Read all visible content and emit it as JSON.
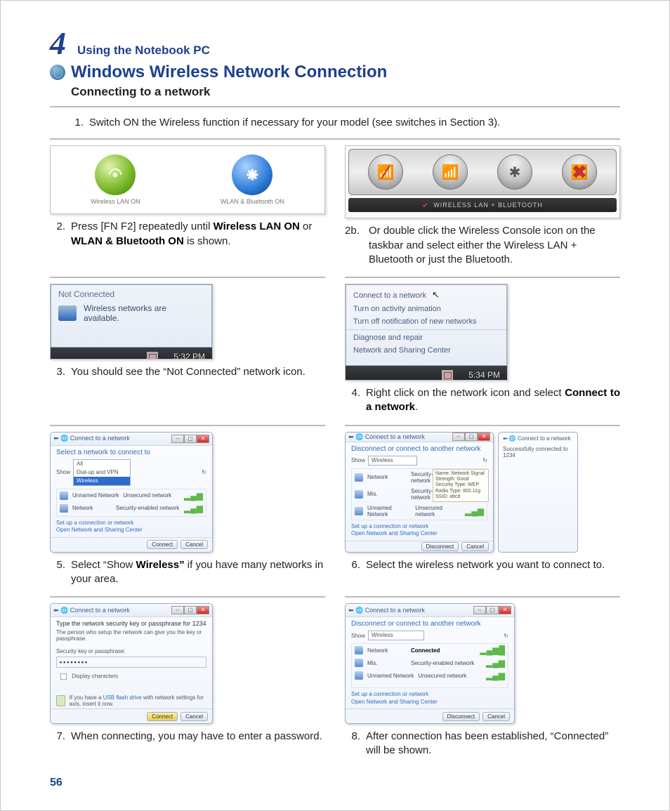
{
  "chapter": {
    "number": "4",
    "title": "Using the Notebook PC"
  },
  "heading": "Windows Wireless Network Connection",
  "subheading": "Connecting to a network",
  "page_number": "56",
  "step1": {
    "num": "1.",
    "text": "Switch ON the Wireless function if necessary for your model (see switches in Section 3)."
  },
  "fig2": {
    "cap1": "Wireless LAN ON",
    "cap2": "WLAN & Bluetooth ON"
  },
  "step2": {
    "num": "2.",
    "pre": "Press [FN F2] repeatedly until ",
    "b1": "Wireless LAN ON",
    "mid": " or ",
    "b2": "WLAN & Bluetooth ON",
    "post": " is shown."
  },
  "fig2b": {
    "label": "WIRELESS LAN + BLUETOOTH"
  },
  "step2b": {
    "num": "2b.",
    "text": "Or double click the Wireless Console icon on the taskbar and select either the Wireless LAN + Bluetooth or just the Bluetooth."
  },
  "fig3": {
    "title": "Not Connected",
    "msg": "Wireless networks are available.",
    "time": "5:32 PM"
  },
  "step3": {
    "num": "3.",
    "text": "You should see the “Not Connected” network icon."
  },
  "fig4": {
    "m1": "Connect to a network",
    "m2": "Turn on activity animation",
    "m3": "Turn off notification of new networks",
    "m4": "Diagnose and repair",
    "m5": "Network and Sharing Center",
    "time": "5:34 PM"
  },
  "step4": {
    "num": "4.",
    "pre": "Right click on the network icon and select ",
    "b": "Connect to a network",
    "post": "."
  },
  "fig5": {
    "wintitle": "Connect to a network",
    "title": "Select a network to connect to",
    "show": "Show",
    "all": "All",
    "dd1": "All",
    "dd2": "Dial-up and VPN",
    "dd3": "Wireless",
    "n2": "Unnamed Network",
    "n2d": "Unsecured network",
    "n3": "Network",
    "n3d": "Security-enabled network",
    "link1": "Set up a connection or network",
    "link2": "Open Network and Sharing Center",
    "btn1": "Connect",
    "btn2": "Cancel"
  },
  "step5": {
    "num": "5.",
    "pre": "Select “Show ",
    "b": "Wireless”",
    "post": " if you have many networks in your area."
  },
  "fig6": {
    "wintitle": "Connect to a network",
    "title": "Disconnect or connect to another network",
    "show": "Show",
    "val": "Wireless",
    "n1": "Network",
    "n1d": "Security-enabled network",
    "n2": "Mis.",
    "n2d": "Security-enabled network",
    "n3": "Unnamed Network",
    "n3d": "Unsecured network",
    "side_top": "Connect to a network",
    "side_msg": "Successfully connected to 1234",
    "tip": "Name: Network\nSignal Strength: Good\nSecurity Type: WEP\nRadio Type: 802.11g\nSSID: abcd",
    "link1": "Set up a connection or network",
    "link2": "Open Network and Sharing Center",
    "btn1": "Disconnect",
    "btn2": "Cancel"
  },
  "step6": {
    "num": "6.",
    "text": "Select the wireless network you want to connect to."
  },
  "fig7": {
    "wintitle": "Connect to a network",
    "title": "Type the network security key or passphrase for 1234",
    "sub": "The person who setup the network can give you the key or passphrase.",
    "label": "Security key or passphrase:",
    "value": "••••••••",
    "chk": "Display characters",
    "hint_pre": "If you have a ",
    "hint_link": "USB flash drive",
    "hint_post": " with network settings for axis, insert it now.",
    "btn1": "Connect",
    "btn2": "Cancel"
  },
  "step7": {
    "num": "7.",
    "text": "When connecting, you may have to enter a password."
  },
  "fig8": {
    "wintitle": "Connect to a network",
    "title": "Disconnect or connect to another network",
    "show": "Show",
    "val": "Wireless",
    "n1": "Network",
    "n1d": "Connected",
    "n2": "Mis.",
    "n2d": "Security-enabled network",
    "n3": "Unnamed Network",
    "n3d": "Unsecured network",
    "link1": "Set up a connection or network",
    "link2": "Open Network and Sharing Center",
    "btn1": "Disconnect",
    "btn2": "Cancel"
  },
  "step8": {
    "num": "8.",
    "text": "After connection has been established, “Connected” will be shown."
  }
}
